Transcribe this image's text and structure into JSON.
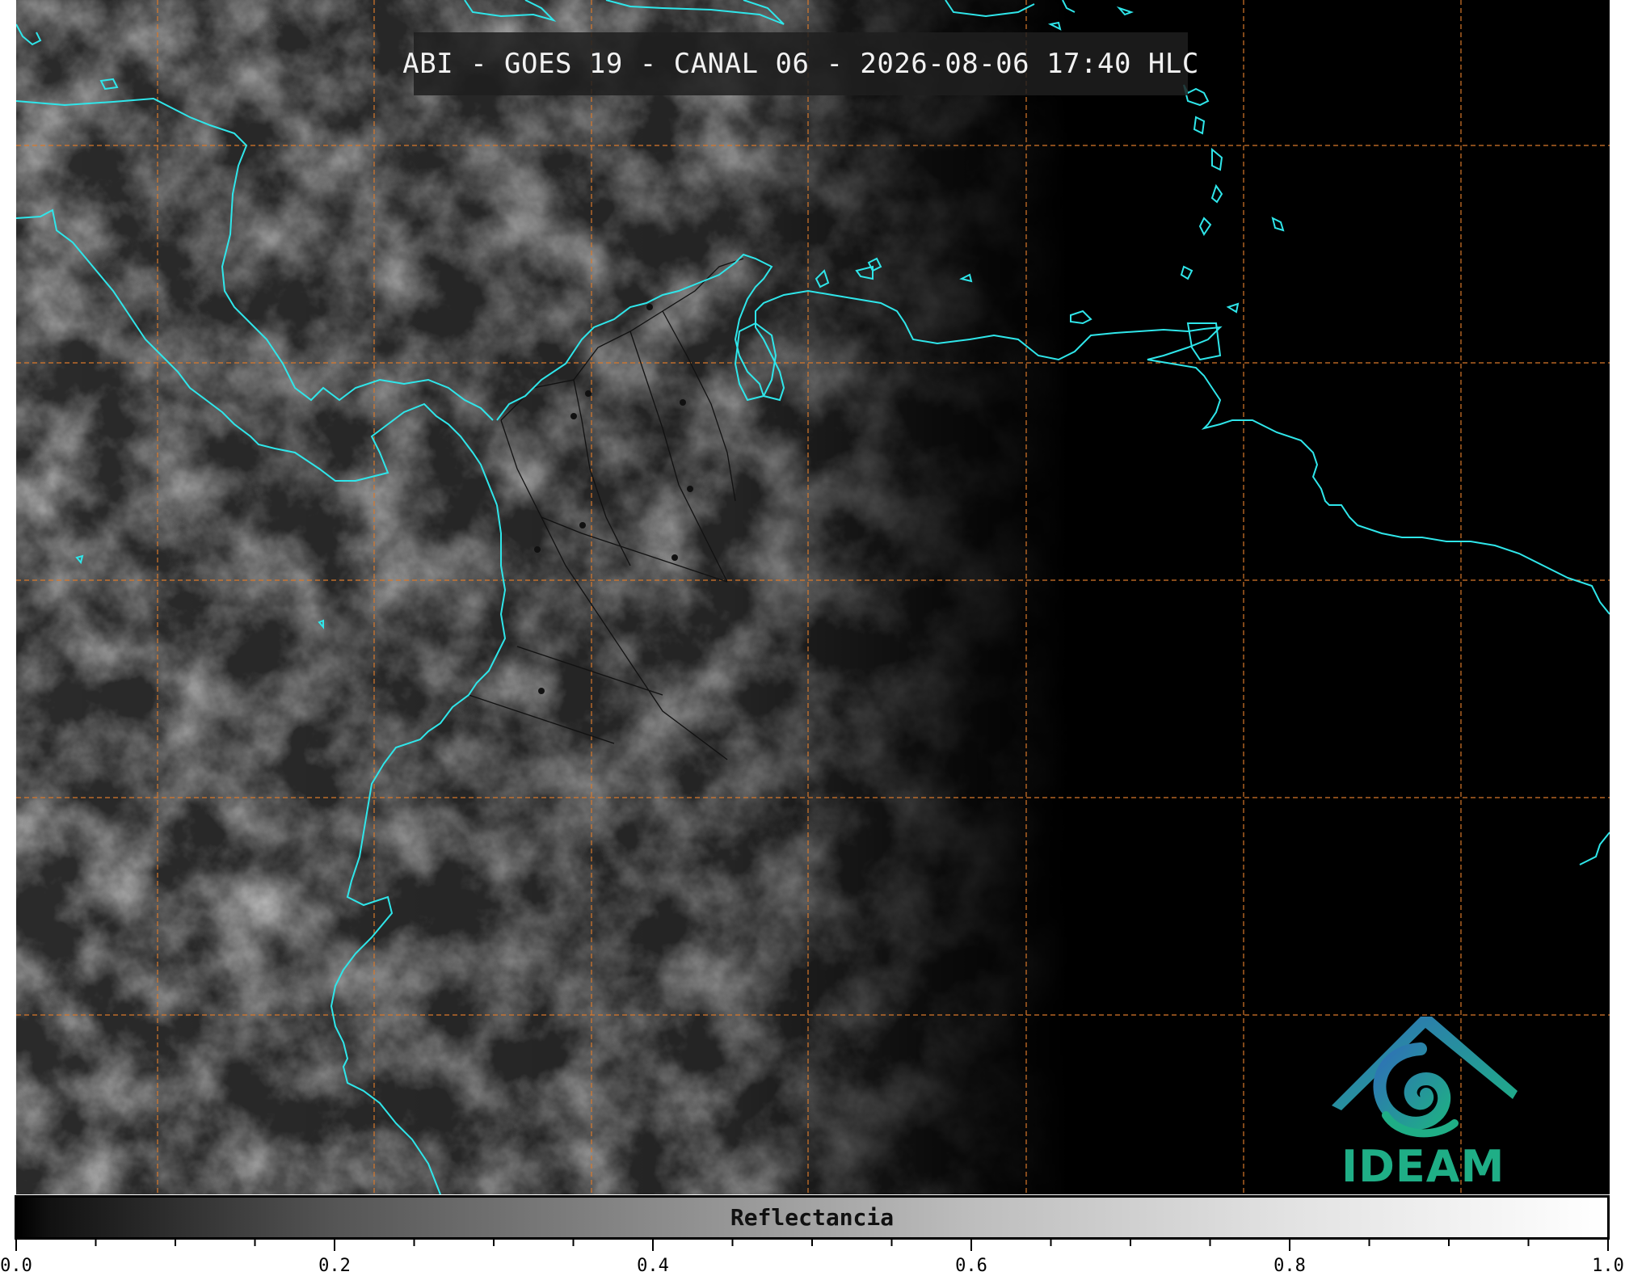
{
  "title": "ABI - GOES 19 - CANAL 06 - 2026-08-06 17:40 HLC",
  "colorbar": {
    "label": "Reflectancia",
    "ticks": [
      "0.0",
      "0.2",
      "0.4",
      "0.6",
      "0.8",
      "1.0"
    ],
    "min": 0.0,
    "max": 1.0
  },
  "logo": {
    "text": "IDEAM",
    "color_primary": "#1fae86",
    "color_secondary": "#2f6fb8"
  },
  "colors": {
    "coastline": "#2fe6ea",
    "gridline": "#d9782a",
    "borders": "#111111",
    "background": "#000000"
  },
  "icons": [
    "ideam-logo-icon"
  ]
}
